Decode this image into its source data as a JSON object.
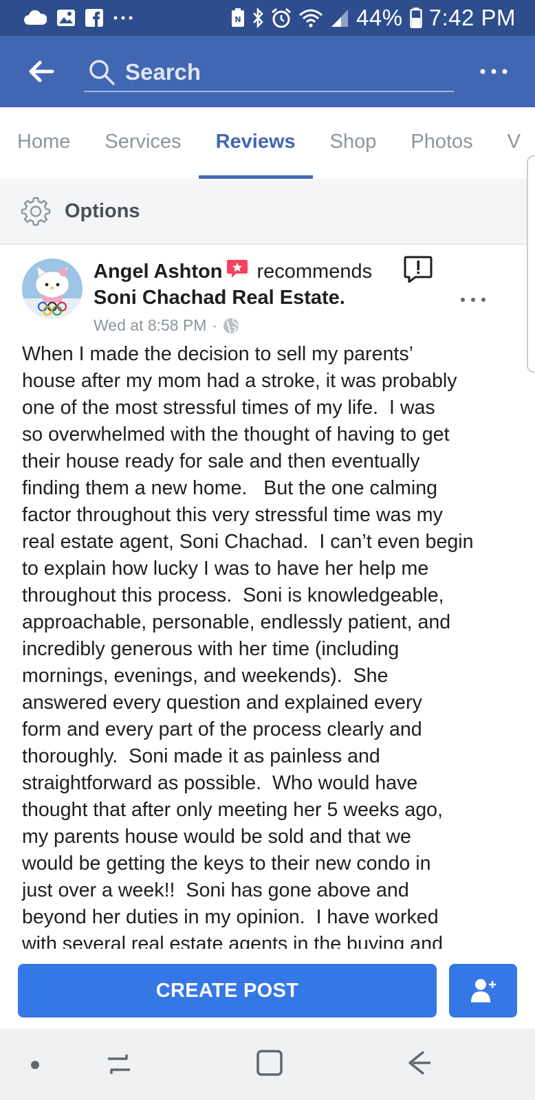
{
  "status_bar": {
    "battery_percent": "44%",
    "time": "7:42 PM",
    "left_icons": [
      "cloud-icon",
      "image-icon",
      "facebook-icon",
      "more-dots-icon"
    ],
    "right_icons": [
      "nfc-icon",
      "bluetooth-icon",
      "alarm-icon",
      "wifi-icon",
      "signal-icon",
      "battery-icon"
    ]
  },
  "header": {
    "search_placeholder": "Search"
  },
  "tabs": [
    {
      "label": "Home",
      "active": false
    },
    {
      "label": "Services",
      "active": false
    },
    {
      "label": "Reviews",
      "active": true
    },
    {
      "label": "Shop",
      "active": false
    },
    {
      "label": "Photos",
      "active": false
    },
    {
      "label": "V",
      "active": false
    }
  ],
  "options": {
    "label": "Options"
  },
  "post": {
    "author": "Angel Ashton",
    "verb": "recommends",
    "page": "Soni Chachad Real Estate.",
    "timestamp": "Wed at 8:58 PM",
    "separator": "·",
    "body": "When I made the decision to sell my parents’\nhouse after my mom had a stroke, it was probably\none of the most stressful times of my life.  I was\nso overwhelmed with the thought of having to get\ntheir house ready for sale and then eventually\nfinding them a new home.   But the one calming\nfactor throughout this very stressful time was my\nreal estate agent, Soni Chachad.  I can’t even begin\nto explain how lucky I was to have her help me\nthroughout this process.  Soni is knowledgeable,\napproachable, personable, endlessly patient, and\nincredibly generous with her time (including\nmornings, evenings, and weekends).  She\nanswered every question and explained every\nform and every part of the process clearly and\nthoroughly.  Soni made it as painless and\nstraightforward as possible.  Who would have\nthought that after only meeting her 5 weeks ago,\nmy parents house would be sold and that we\nwould be getting the keys to their new condo in\njust over a week!!  Soni has gone above and\nbeyond her duties in my opinion.  I have worked\nwith several real estate agents in the buying and"
  },
  "action_bar": {
    "create_post_label": "CREATE POST"
  },
  "colors": {
    "status_bar": "#2d4d8c",
    "header": "#4267b2",
    "accent": "#4267b2",
    "button": "#3578e5",
    "recommend_badge": "#f3425f"
  }
}
